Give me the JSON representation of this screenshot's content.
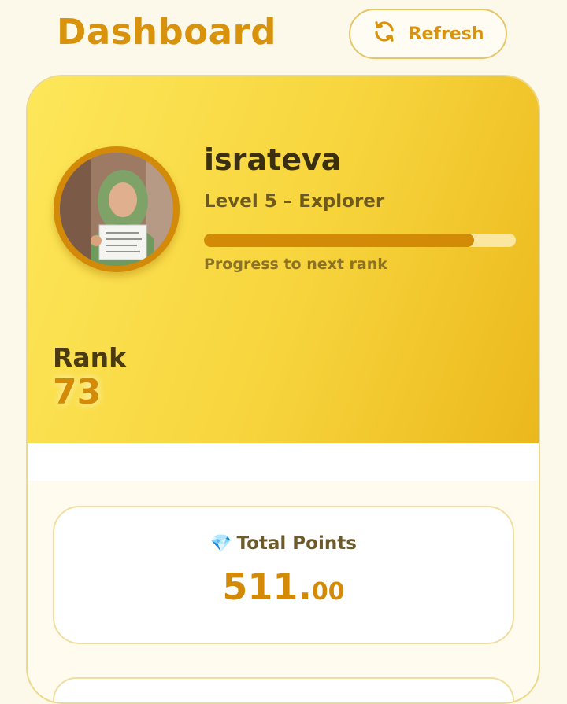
{
  "header": {
    "title": "Dashboard",
    "refresh_label": "Refresh"
  },
  "profile": {
    "username": "israteva",
    "level": "Level 5 – Explorer",
    "progress": 0.865,
    "progress_caption": "Progress to next rank",
    "rank_label": "Rank",
    "rank_value": "73"
  },
  "stats": {
    "total_points_label": "Total Points",
    "total_points_icon": "gem-icon",
    "total_points_int": "511.",
    "total_points_dec": "00"
  },
  "colors": {
    "accent": "#d9920c",
    "hero_start": "#fde75a",
    "hero_end": "#ebb81c"
  }
}
